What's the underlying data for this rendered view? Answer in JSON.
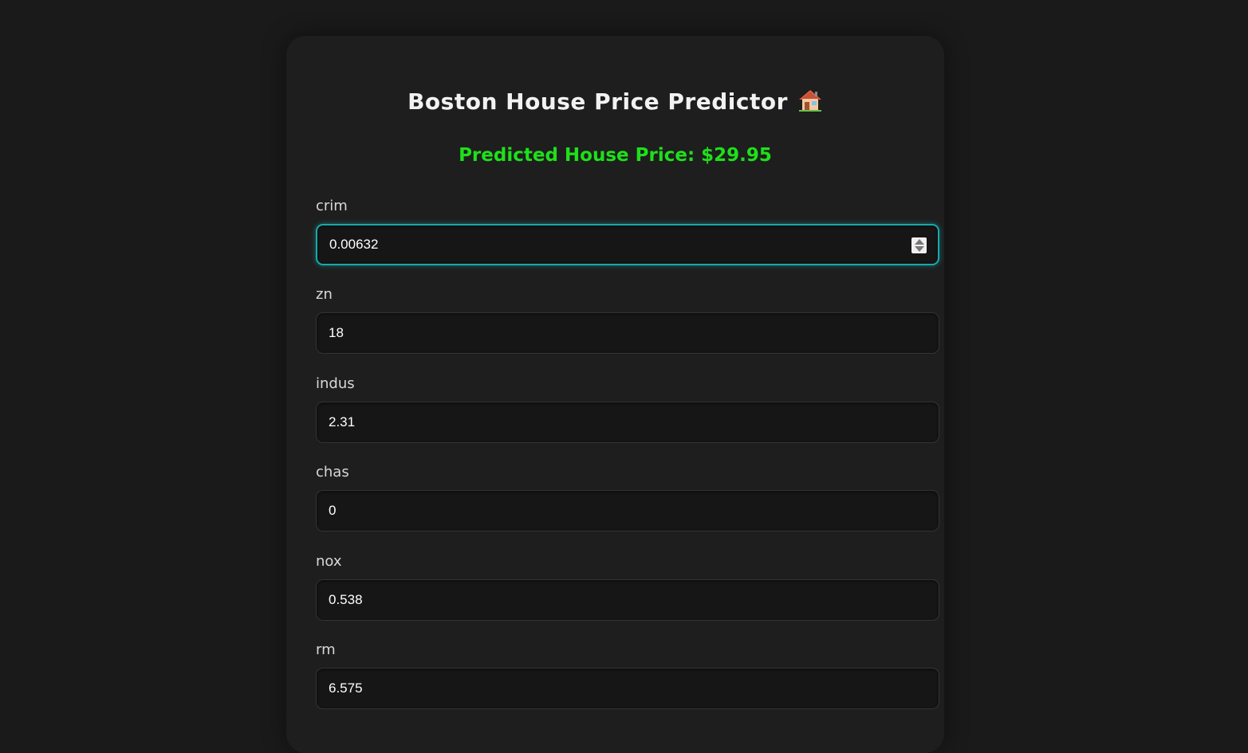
{
  "app": {
    "title": "Boston House Price Predictor",
    "title_icon": "house-icon",
    "prediction_text": "Predicted House Price: $29.95"
  },
  "colors": {
    "background": "#1a1a1a",
    "card": "#1e1e1e",
    "prediction": "#1ee01a",
    "focus_border": "#1aa8a8"
  },
  "fields": [
    {
      "label": "crim",
      "value": "0.00632",
      "focused": true
    },
    {
      "label": "zn",
      "value": "18",
      "focused": false
    },
    {
      "label": "indus",
      "value": "2.31",
      "focused": false
    },
    {
      "label": "chas",
      "value": "0",
      "focused": false
    },
    {
      "label": "nox",
      "value": "0.538",
      "focused": false
    },
    {
      "label": "rm",
      "value": "6.575",
      "focused": false
    }
  ]
}
